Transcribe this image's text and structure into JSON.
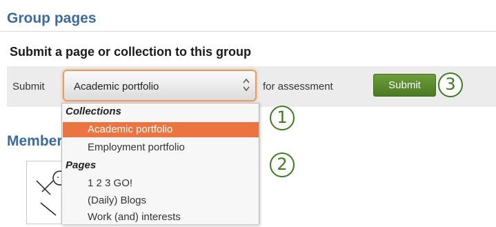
{
  "header": {
    "title": "Group pages"
  },
  "submit_section": {
    "heading": "Submit a page or collection to this group",
    "label_prefix": "Submit",
    "label_suffix": "for assessment",
    "select_value": "Academic portfolio",
    "submit_label": "Submit"
  },
  "dropdown": {
    "groups": [
      {
        "label": "Collections",
        "options": [
          "Academic portfolio",
          "Employment portfolio"
        ]
      },
      {
        "label": "Pages",
        "options": [
          "1 2 3 GO!",
          "(Daily) Blogs",
          "Work (and) interests"
        ]
      }
    ],
    "selected": "Academic portfolio"
  },
  "callouts": [
    "1",
    "2",
    "3"
  ],
  "members": {
    "heading": "Members"
  },
  "colors": {
    "title_blue": "#3b6a9e",
    "highlight_orange": "#eb7440",
    "button_green": "#5a8a2e",
    "callout_green": "#3c7a1e"
  }
}
